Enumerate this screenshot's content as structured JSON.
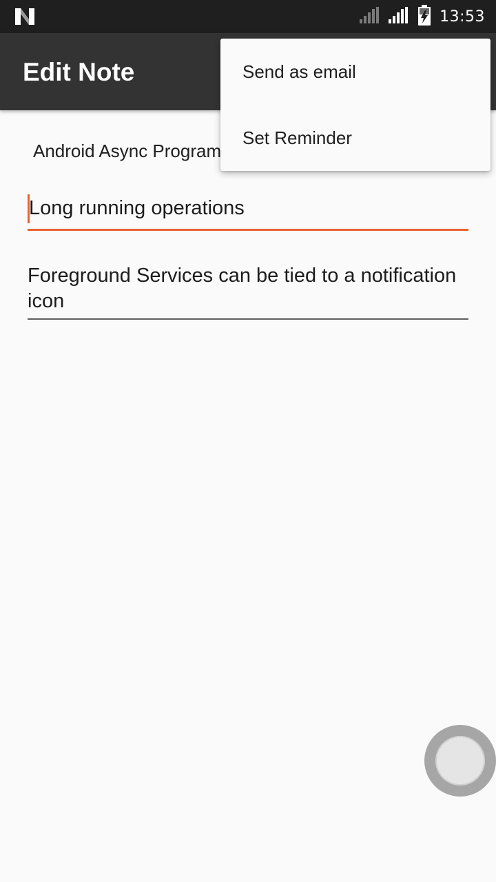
{
  "status_bar": {
    "time": "13:53",
    "icons": [
      "n-logo-icon",
      "signal-1-icon",
      "signal-2-icon",
      "battery-charging-icon"
    ]
  },
  "app_bar": {
    "title": "Edit Note"
  },
  "note": {
    "course": "Android Async Programming and Services",
    "title": "Long running operations",
    "text": "Foreground Services can be tied to a notification icon"
  },
  "overflow_menu": {
    "items": [
      {
        "label": "Send as email"
      },
      {
        "label": "Set Reminder"
      }
    ]
  },
  "colors": {
    "app_bar": "#333333",
    "status_bar": "#1f1f1f",
    "accent": "#e8622f",
    "background": "#fafafa"
  }
}
